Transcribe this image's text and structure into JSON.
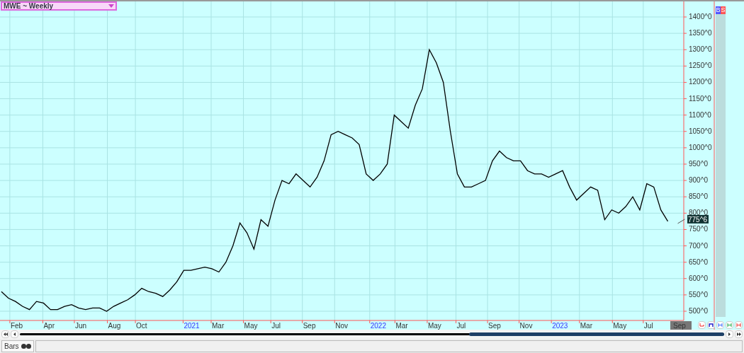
{
  "chart_selector": {
    "label": "MWE ~ Weekly"
  },
  "chart": {
    "x_axis_labels": [
      {
        "label": "Feb",
        "kind": "month"
      },
      {
        "label": "Apr",
        "kind": "month"
      },
      {
        "label": "Jun",
        "kind": "month"
      },
      {
        "label": "Aug",
        "kind": "month"
      },
      {
        "label": "Oct",
        "kind": "month"
      },
      {
        "label": "2021",
        "kind": "year"
      },
      {
        "label": "Mar",
        "kind": "month"
      },
      {
        "label": "May",
        "kind": "month"
      },
      {
        "label": "Jul",
        "kind": "month"
      },
      {
        "label": "Sep",
        "kind": "month"
      },
      {
        "label": "Nov",
        "kind": "month"
      },
      {
        "label": "2022",
        "kind": "year"
      },
      {
        "label": "Mar",
        "kind": "month"
      },
      {
        "label": "May",
        "kind": "month"
      },
      {
        "label": "Jul",
        "kind": "month"
      },
      {
        "label": "Sep",
        "kind": "month"
      },
      {
        "label": "Nov",
        "kind": "month"
      },
      {
        "label": "2023",
        "kind": "year"
      },
      {
        "label": "Mar",
        "kind": "month"
      },
      {
        "label": "May",
        "kind": "month"
      },
      {
        "label": "Jul",
        "kind": "month"
      }
    ],
    "y_axis_labels": [
      "1400^0",
      "1350^0",
      "1300^0",
      "1250^0",
      "1200^0",
      "1150^0",
      "1100^0",
      "1050^0",
      "1000^0",
      "950^0",
      "900^0",
      "850^0",
      "800^0",
      "750^0",
      "700^0",
      "650^0",
      "600^0",
      "550^0",
      "500^0"
    ],
    "last_price": "775^6",
    "cursor_label": "Sep"
  },
  "side_buttons": [
    {
      "label": "B",
      "color": "#5555ff"
    },
    {
      "label": "S",
      "color": "#ff5555"
    }
  ],
  "bottom_tabs": [
    {
      "label": "Bars",
      "selected": true
    }
  ]
}
